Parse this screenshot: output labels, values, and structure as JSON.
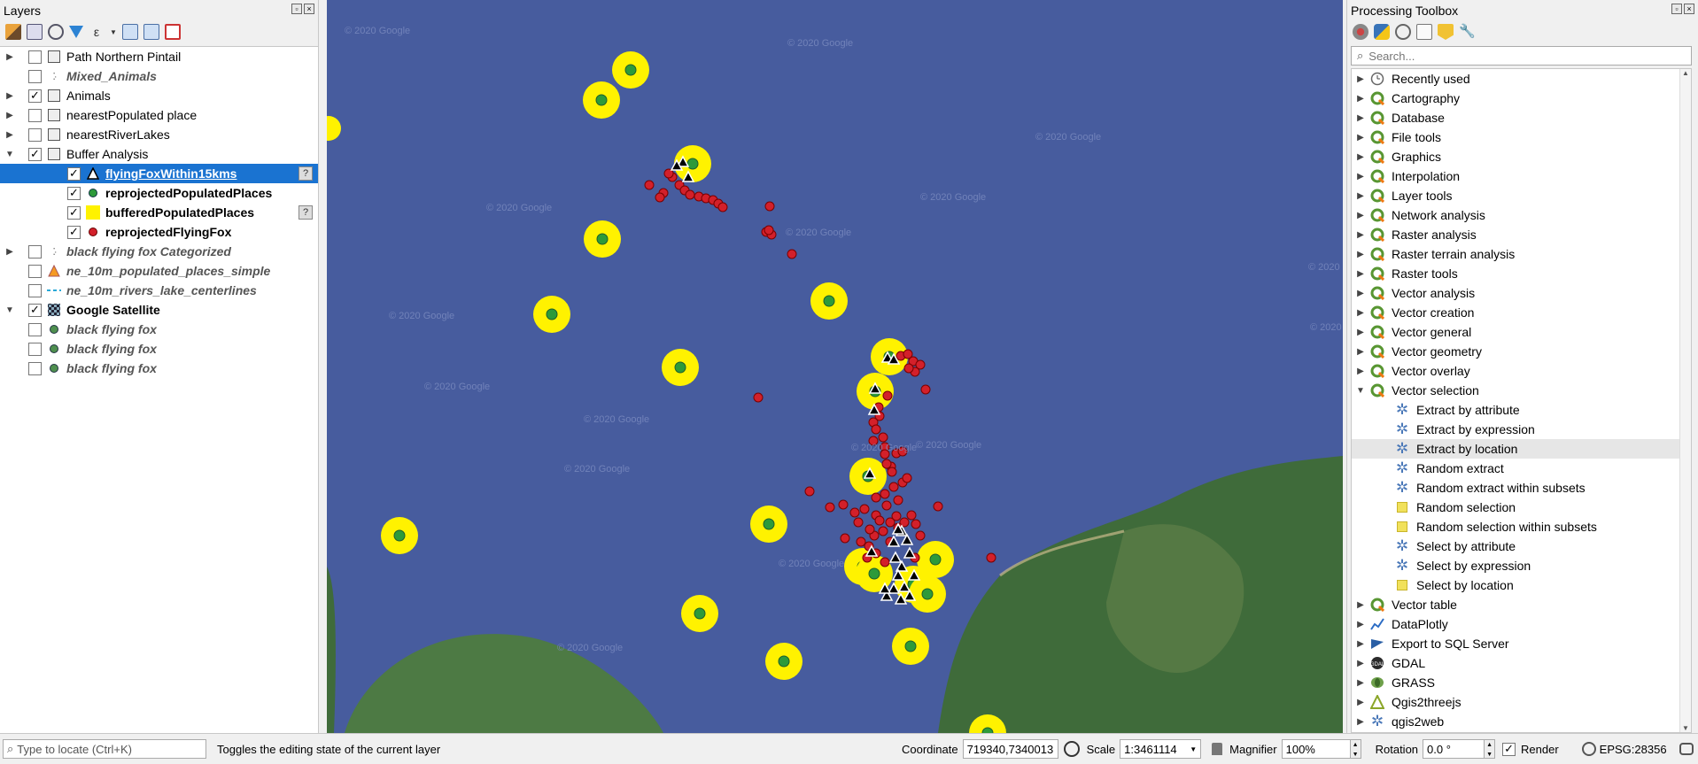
{
  "layers_panel": {
    "title": "Layers",
    "layers": [
      {
        "label": "Path Northern Pintail",
        "checked": false,
        "expander": "▶",
        "style": "",
        "indent": 0,
        "sym": "group"
      },
      {
        "label": "Mixed_Animals",
        "checked": false,
        "expander": "",
        "style": "italic",
        "indent": 0,
        "sym": "points"
      },
      {
        "label": "Animals",
        "checked": true,
        "expander": "▶",
        "style": "",
        "indent": 0,
        "sym": "group"
      },
      {
        "label": "nearestPopulated place",
        "checked": false,
        "expander": "▶",
        "style": "",
        "indent": 0,
        "sym": "group"
      },
      {
        "label": "nearestRiverLakes",
        "checked": false,
        "expander": "▶",
        "style": "",
        "indent": 0,
        "sym": "group"
      },
      {
        "label": "Buffer Analysis",
        "checked": true,
        "expander": "▼",
        "style": "",
        "indent": 0,
        "sym": "group"
      },
      {
        "label": "flyingFoxWithin15kms",
        "checked": true,
        "expander": "",
        "style": "bold",
        "indent": 1,
        "sym": "triangle",
        "selected": true,
        "help": true
      },
      {
        "label": "reprojectedPopulatedPlaces",
        "checked": true,
        "expander": "",
        "style": "bold",
        "indent": 1,
        "sym": "green-dot"
      },
      {
        "label": "bufferedPopulatedPlaces",
        "checked": true,
        "expander": "",
        "style": "bold",
        "indent": 1,
        "sym": "yellow-square",
        "help": true
      },
      {
        "label": "reprojectedFlyingFox",
        "checked": true,
        "expander": "",
        "style": "bold",
        "indent": 1,
        "sym": "red-dot"
      },
      {
        "label": "black flying fox Categorized",
        "checked": false,
        "expander": "▶",
        "style": "italic",
        "indent": 0,
        "sym": "points"
      },
      {
        "label": "ne_10m_populated_places_simple",
        "checked": false,
        "expander": "",
        "style": "italic",
        "indent": 0,
        "sym": "orange-triangle"
      },
      {
        "label": "ne_10m_rivers_lake_centerlines",
        "checked": false,
        "expander": "",
        "style": "italic",
        "indent": 0,
        "sym": "dash-line"
      },
      {
        "label": "Google Satellite",
        "checked": true,
        "expander": "▼",
        "style": "bold",
        "indent": 0,
        "sym": "raster"
      },
      {
        "label": "black flying fox",
        "checked": false,
        "expander": "",
        "style": "italic",
        "indent": 0,
        "sym": "green-dot-small"
      },
      {
        "label": "black flying fox",
        "checked": false,
        "expander": "",
        "style": "italic",
        "indent": 0,
        "sym": "green-dot-small"
      },
      {
        "label": "black flying fox",
        "checked": false,
        "expander": "",
        "style": "italic",
        "indent": 0,
        "sym": "green-dot-small"
      }
    ]
  },
  "map": {
    "watermark": "© 2020 Google",
    "colors": {
      "water": "#475c9e",
      "land": "#3f6b3a",
      "buffer": "#fff200",
      "place": "#2d9a3a",
      "fox": "#d3202a"
    }
  },
  "toolbox": {
    "title": "Processing Toolbox",
    "search_placeholder": "Search...",
    "items": [
      {
        "label": "Recently used",
        "icon": "clock-icon",
        "expander": "▶"
      },
      {
        "label": "Cartography",
        "icon": "qgis-icon",
        "expander": "▶"
      },
      {
        "label": "Database",
        "icon": "qgis-icon",
        "expander": "▶"
      },
      {
        "label": "File tools",
        "icon": "qgis-icon",
        "expander": "▶"
      },
      {
        "label": "Graphics",
        "icon": "qgis-icon",
        "expander": "▶"
      },
      {
        "label": "Interpolation",
        "icon": "qgis-icon",
        "expander": "▶"
      },
      {
        "label": "Layer tools",
        "icon": "qgis-icon",
        "expander": "▶"
      },
      {
        "label": "Network analysis",
        "icon": "qgis-icon",
        "expander": "▶"
      },
      {
        "label": "Raster analysis",
        "icon": "qgis-icon",
        "expander": "▶"
      },
      {
        "label": "Raster terrain analysis",
        "icon": "qgis-icon",
        "expander": "▶"
      },
      {
        "label": "Raster tools",
        "icon": "qgis-icon",
        "expander": "▶"
      },
      {
        "label": "Vector analysis",
        "icon": "qgis-icon",
        "expander": "▶"
      },
      {
        "label": "Vector creation",
        "icon": "qgis-icon",
        "expander": "▶"
      },
      {
        "label": "Vector general",
        "icon": "qgis-icon",
        "expander": "▶"
      },
      {
        "label": "Vector geometry",
        "icon": "qgis-icon",
        "expander": "▶"
      },
      {
        "label": "Vector overlay",
        "icon": "qgis-icon",
        "expander": "▶"
      },
      {
        "label": "Vector selection",
        "icon": "qgis-icon",
        "expander": "▼"
      },
      {
        "label": "Extract by attribute",
        "icon": "gear-icon",
        "sub": true
      },
      {
        "label": "Extract by expression",
        "icon": "gear-icon",
        "sub": true
      },
      {
        "label": "Extract by location",
        "icon": "gear-icon",
        "sub": true,
        "highlight": true
      },
      {
        "label": "Random extract",
        "icon": "gear-icon",
        "sub": true
      },
      {
        "label": "Random extract within subsets",
        "icon": "gear-icon",
        "sub": true
      },
      {
        "label": "Random selection",
        "icon": "select-icon",
        "sub": true
      },
      {
        "label": "Random selection within subsets",
        "icon": "select-icon",
        "sub": true
      },
      {
        "label": "Select by attribute",
        "icon": "gear-icon",
        "sub": true
      },
      {
        "label": "Select by expression",
        "icon": "gear-icon",
        "sub": true
      },
      {
        "label": "Select by location",
        "icon": "select-icon",
        "sub": true
      },
      {
        "label": "Vector table",
        "icon": "qgis-icon",
        "expander": "▶"
      },
      {
        "label": "DataPlotly",
        "icon": "plot-icon",
        "expander": "▶"
      },
      {
        "label": "Export to SQL Server",
        "icon": "sqlserver-icon",
        "expander": "▶"
      },
      {
        "label": "GDAL",
        "icon": "gdal-icon",
        "expander": "▶"
      },
      {
        "label": "GRASS",
        "icon": "grass-icon",
        "expander": "▶"
      },
      {
        "label": "Qgis2threejs",
        "icon": "threejs-icon",
        "expander": "▶"
      },
      {
        "label": "qgis2web",
        "icon": "gear-icon",
        "expander": "▶"
      }
    ]
  },
  "status_bar": {
    "locator_placeholder": "Type to locate (Ctrl+K)",
    "message": "Toggles the editing state of the current layer",
    "coordinate_label": "Coordinate",
    "coordinate_value": "719340,7340013",
    "scale_label": "Scale",
    "scale_value": "1:3461114",
    "magnifier_label": "Magnifier",
    "magnifier_value": "100%",
    "rotation_label": "Rotation",
    "rotation_value": "0.0 °",
    "render_label": "Render",
    "render_checked": true,
    "crs": "EPSG:28356"
  }
}
